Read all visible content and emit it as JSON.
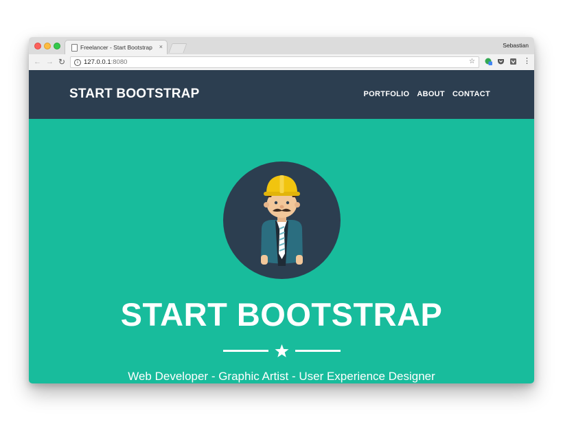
{
  "browser": {
    "tab_title": "Freelancer - Start Bootstrap Th",
    "tab_close": "×",
    "profile_name": "Sebastian",
    "url_host": "127.0.0.1",
    "url_port": ":8080"
  },
  "site": {
    "brand": "START BOOTSTRAP",
    "nav": [
      "PORTFOLIO",
      "ABOUT",
      "CONTACT"
    ],
    "nav_bg": "#2c3e50"
  },
  "hero": {
    "title": "START BOOTSTRAP",
    "subtitle": "Web Developer - Graphic Artist - User Experience Designer",
    "bg": "#18bc9c",
    "divider_icon": "star-icon",
    "avatar_icon": "construction-worker-avatar-icon"
  },
  "colors": {
    "accent": "#18bc9c",
    "primary": "#2c3e50"
  }
}
